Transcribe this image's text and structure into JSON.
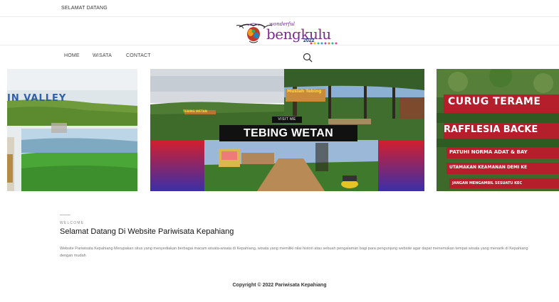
{
  "topbar": {
    "welcome_text": "SELAMAT DATANG"
  },
  "logo": {
    "wonderful": "wonderful",
    "brand": "bengkulu",
    "year": "2022"
  },
  "nav": {
    "items": [
      {
        "label": "HOME"
      },
      {
        "label": "WISATA"
      },
      {
        "label": "CONTACT"
      }
    ],
    "search_icon": "search-icon"
  },
  "slider": {
    "slides": [
      {
        "sign": "IN VALLEY"
      },
      {
        "sign": "TEBING WETAN",
        "button": "VISIT ME",
        "title": "TEBING WETAN",
        "small_sign": "TEBING WETAN",
        "pond_sign": "Muslah Tebing"
      },
      {
        "sign_1": "CURUG TERAME",
        "sign_2": "RAFFLESIA BACKE",
        "sign_3": "PATUHI NORMA ADAT & BAY",
        "sign_4": "UTAMAKAN KEAMANAN DEMI KE",
        "sign_5": "JANGAN MENGAMBIL SESUATU KEC"
      }
    ]
  },
  "content": {
    "label": "WELCOME",
    "heading": "Selamat Datang Di Website Pariwisata Kepahiang",
    "description": "Website Pariwisata Kepahiang Merupakan situs yang menyediakan berbagai macam wisata-wisata di Kepahiang, wisata yang memiliki nilai histori atau sebuah pengalaman bagi para pengunjung website agar dapat menemukan tempat wisata yang menarik di Kepahiang dengan mudah"
  },
  "footer": {
    "copyright": "Copyright © 2022 Pariwisata Kepahiang"
  }
}
